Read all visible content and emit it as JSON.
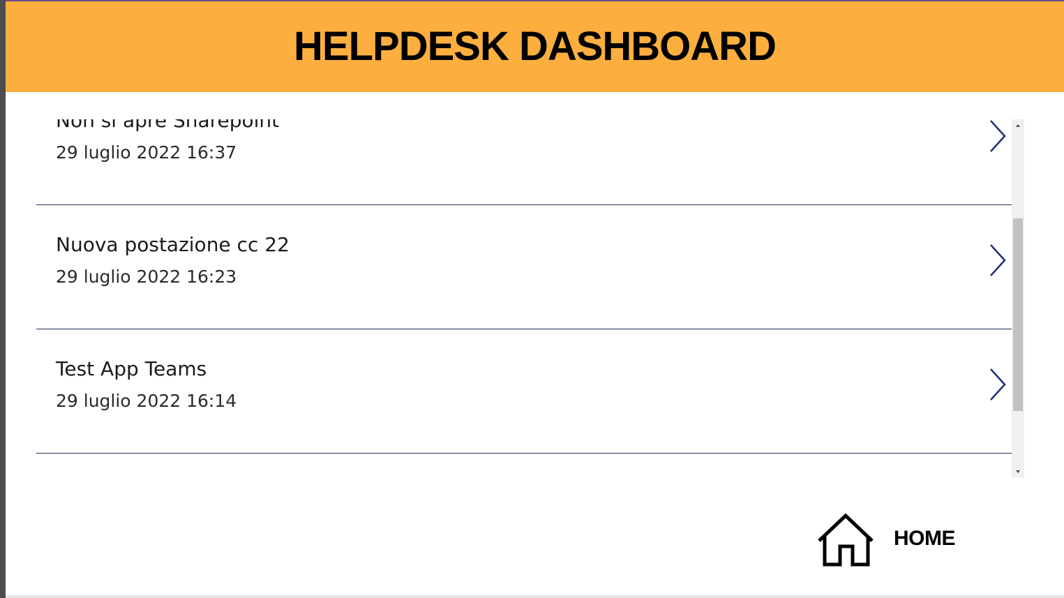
{
  "header": {
    "title": "HELPDESK DASHBOARD"
  },
  "tickets": [
    {
      "title": "Non si apre Sharepoint",
      "date": "29 luglio 2022 16:37"
    },
    {
      "title": "Nuova postazione cc 22",
      "date": "29 luglio 2022 16:23"
    },
    {
      "title": "Test App Teams",
      "date": "29 luglio 2022 16:14"
    }
  ],
  "footer": {
    "home_label": "HOME"
  },
  "colors": {
    "header_bg": "#fcaf3e",
    "divider": "#1f2d5a",
    "chevron": "#1f2d7a"
  },
  "icons": {
    "item_arrow": "chevron-right-icon",
    "home": "home-icon"
  }
}
